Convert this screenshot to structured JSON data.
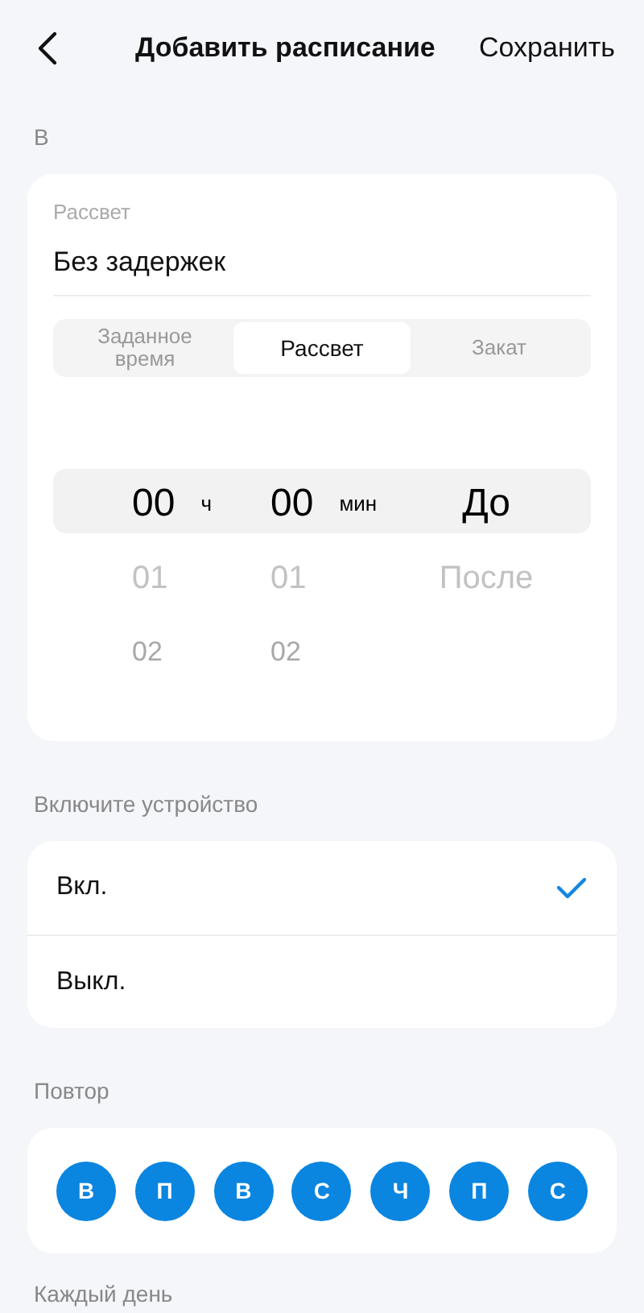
{
  "header": {
    "title": "Добавить расписание",
    "save": "Сохранить"
  },
  "section_time": {
    "label": "В",
    "field": {
      "label": "Рассвет",
      "value": "Без задержек"
    },
    "modes": [
      {
        "label": "Заданное время",
        "selected": false
      },
      {
        "label": "Рассвет",
        "selected": true
      },
      {
        "label": "Закат",
        "selected": false
      }
    ],
    "picker": {
      "hours": [
        "00",
        "01",
        "02"
      ],
      "hours_unit": "ч",
      "minutes": [
        "00",
        "01",
        "02"
      ],
      "minutes_unit": "мин",
      "offset": [
        "До",
        "После"
      ]
    }
  },
  "section_action": {
    "label": "Включите устройство",
    "options": [
      {
        "label": "Вкл.",
        "selected": true
      },
      {
        "label": "Выкл.",
        "selected": false
      }
    ]
  },
  "section_repeat": {
    "label": "Повтор",
    "days": [
      {
        "label": "В",
        "selected": true
      },
      {
        "label": "П",
        "selected": true
      },
      {
        "label": "В",
        "selected": true
      },
      {
        "label": "С",
        "selected": true
      },
      {
        "label": "Ч",
        "selected": true
      },
      {
        "label": "П",
        "selected": true
      },
      {
        "label": "С",
        "selected": true
      }
    ],
    "summary": "Каждый день"
  }
}
